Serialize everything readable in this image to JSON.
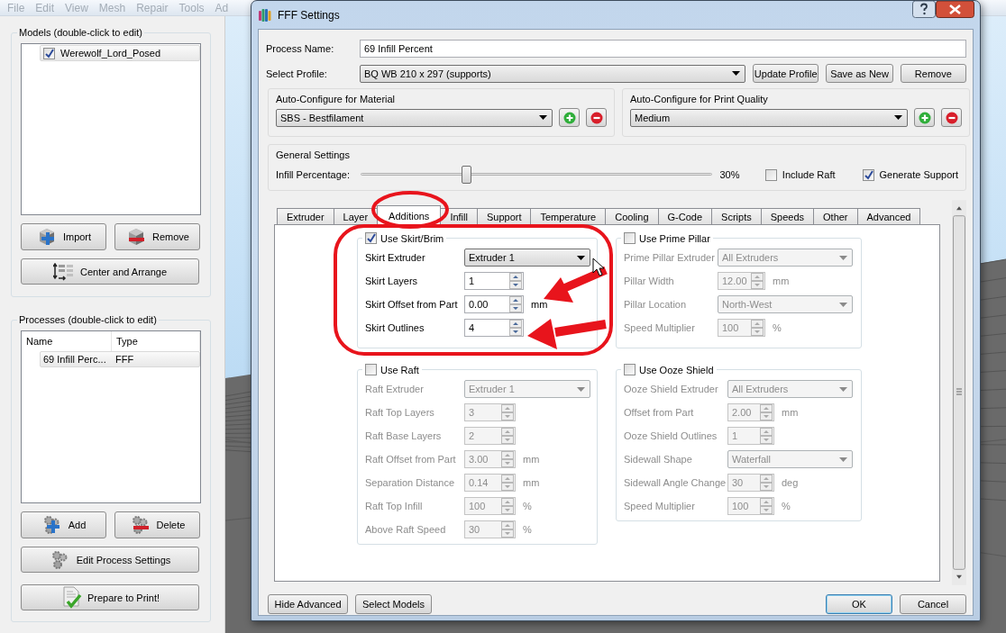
{
  "menu_bar": [
    "File",
    "Edit",
    "View",
    "Mesh",
    "Repair",
    "Tools",
    "Ad"
  ],
  "models_panel": {
    "title": "Models (double-click to edit)",
    "items": [
      {
        "label": "Werewolf_Lord_Posed",
        "checked": true
      }
    ],
    "buttons": [
      {
        "label": "Import",
        "kind": "add"
      },
      {
        "label": "Remove",
        "kind": "remove"
      },
      {
        "label": "Center and Arrange",
        "kind": "arrange"
      }
    ]
  },
  "processes_panel": {
    "title": "Processes (double-click to edit)",
    "columns": [
      "Name",
      "Type"
    ],
    "rows": [
      [
        "69 Infill Perc...",
        "FFF"
      ]
    ],
    "buttons": [
      {
        "label": "Add",
        "kind": "add"
      },
      {
        "label": "Delete",
        "kind": "remove"
      },
      {
        "label": "Edit Process Settings",
        "kind": "edit"
      },
      {
        "label": "Prepare to Print!",
        "kind": "print"
      }
    ]
  },
  "dialog": {
    "title": "FFF Settings",
    "process_name": {
      "label": "Process Name:",
      "value": "69 Infill Percent"
    },
    "profile": {
      "label": "Select Profile:",
      "value": "BQ WB 210 x 297 (supports)",
      "buttons": [
        "Update Profile",
        "Save as New",
        "Remove"
      ]
    },
    "auto_configure": [
      {
        "title": "Auto-Configure for Material",
        "value": "SBS - Bestfilament"
      },
      {
        "title": "Auto-Configure for Print Quality",
        "value": "Medium"
      }
    ],
    "general_settings": {
      "title": "General Settings",
      "slider_label": "Infill Percentage:",
      "level": 0.3,
      "reading": "30%",
      "checkboxes": [
        {
          "label": "Include Raft",
          "checked": false
        },
        {
          "label": "Generate Support",
          "checked": true
        }
      ]
    },
    "tabs": [
      {
        "label": "Extruder",
        "selected": false
      },
      {
        "label": "Layer",
        "selected": false
      },
      {
        "label": "Additions",
        "selected": true
      },
      {
        "label": "Infill",
        "selected": false
      },
      {
        "label": "Support",
        "selected": false
      },
      {
        "label": "Temperature",
        "selected": false
      },
      {
        "label": "Cooling",
        "selected": false
      },
      {
        "label": "G-Code",
        "selected": false
      },
      {
        "label": "Scripts",
        "selected": false
      },
      {
        "label": "Speeds",
        "selected": false
      },
      {
        "label": "Other",
        "selected": false
      },
      {
        "label": "Advanced",
        "selected": false
      }
    ],
    "groups": [
      {
        "title": "Use Skirt/Brim",
        "checked": true,
        "rows": [
          {
            "kind": "dropdown",
            "label": "Skirt Extruder",
            "value": "Extruder 1"
          },
          {
            "kind": "spin",
            "label": "Skirt Layers",
            "value": "1"
          },
          {
            "kind": "spin",
            "label": "Skirt Offset from Part",
            "value": "0.00",
            "unit": "mm"
          },
          {
            "kind": "spin",
            "label": "Skirt Outlines",
            "value": "4"
          }
        ]
      },
      {
        "title": "Use Prime Pillar",
        "checked": false,
        "rows": [
          {
            "kind": "dropdown",
            "label": "Prime Pillar Extruder",
            "value": "All Extruders"
          },
          {
            "kind": "spin",
            "label": "Pillar Width",
            "value": "12.00",
            "unit": "mm"
          },
          {
            "kind": "dropdown",
            "label": "Pillar Location",
            "value": "North-West"
          },
          {
            "kind": "spin",
            "label": "Speed Multiplier",
            "value": "100",
            "unit": "%"
          }
        ]
      },
      {
        "title": "Use Raft",
        "checked": false,
        "rows": [
          {
            "kind": "dropdown",
            "label": "Raft Extruder",
            "value": "Extruder 1"
          },
          {
            "kind": "spin",
            "label": "Raft Top Layers",
            "value": "3"
          },
          {
            "kind": "spin",
            "label": "Raft Base Layers",
            "value": "2"
          },
          {
            "kind": "spin",
            "label": "Raft Offset from Part",
            "value": "3.00",
            "unit": "mm"
          },
          {
            "kind": "spin",
            "label": "Separation Distance",
            "value": "0.14",
            "unit": "mm"
          },
          {
            "kind": "spin",
            "label": "Raft Top Infill",
            "value": "100",
            "unit": "%"
          },
          {
            "kind": "spin",
            "label": "Above Raft Speed",
            "value": "30",
            "unit": "%"
          }
        ]
      },
      {
        "title": "Use Ooze Shield",
        "checked": false,
        "rows": [
          {
            "kind": "dropdown",
            "label": "Ooze Shield Extruder",
            "value": "All Extruders"
          },
          {
            "kind": "spin",
            "label": "Offset from Part",
            "value": "2.00",
            "unit": "mm"
          },
          {
            "kind": "spin",
            "label": "Ooze Shield Outlines",
            "value": "1"
          },
          {
            "kind": "dropdown",
            "label": "Sidewall Shape",
            "value": "Waterfall"
          },
          {
            "kind": "spin",
            "label": "Sidewall Angle Change",
            "value": "30",
            "unit": "deg"
          },
          {
            "kind": "spin",
            "label": "Speed Multiplier",
            "value": "100",
            "unit": "%"
          }
        ]
      }
    ],
    "buttons_left": [
      "Hide Advanced",
      "Select Models"
    ],
    "buttons_right": [
      {
        "label": "OK",
        "default": true
      },
      {
        "label": "Cancel",
        "default": false
      }
    ]
  }
}
